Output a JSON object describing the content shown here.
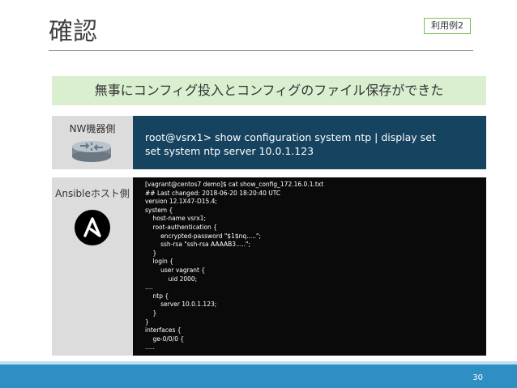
{
  "slide": {
    "title": "確認",
    "badge": "利用例2",
    "banner": "無事にコンフィグ投入とコンフィグのファイル保存ができた",
    "page_number": "30"
  },
  "nw_row": {
    "label": "NW機器側",
    "icon": "router-icon",
    "lines": [
      "root@vsrx1> show configuration system ntp | display set",
      "set system ntp server 10.0.1.123"
    ]
  },
  "ansible_row": {
    "label": "Ansibleホスト側",
    "icon": "ansible-logo",
    "lines": [
      "[vagrant@centos7 demo]$ cat show_config_172.16.0.1.txt",
      "## Last changed: 2018-06-20 18:20:40 UTC",
      "version 12.1X47-D15.4;",
      "system {",
      "    host-name vsrx1;",
      "    root-authentication {",
      "        encrypted-password \"$1$nq.....\";",
      "        ssh-rsa \"ssh-rsa AAAAB3.....\";",
      "    }",
      "    login {",
      "        user vagrant {",
      "            uid 2000;",
      "....",
      "    ntp {",
      "        server 10.0.1.123;",
      "    }",
      "}",
      "interfaces {",
      "    ge-0/0/0 {",
      "....."
    ]
  },
  "colors": {
    "banner_bg": "#d9efd0",
    "nw_panel_bg": "#16435f",
    "code_bg": "#0a0a0a",
    "footer": "#2f8ec2"
  }
}
